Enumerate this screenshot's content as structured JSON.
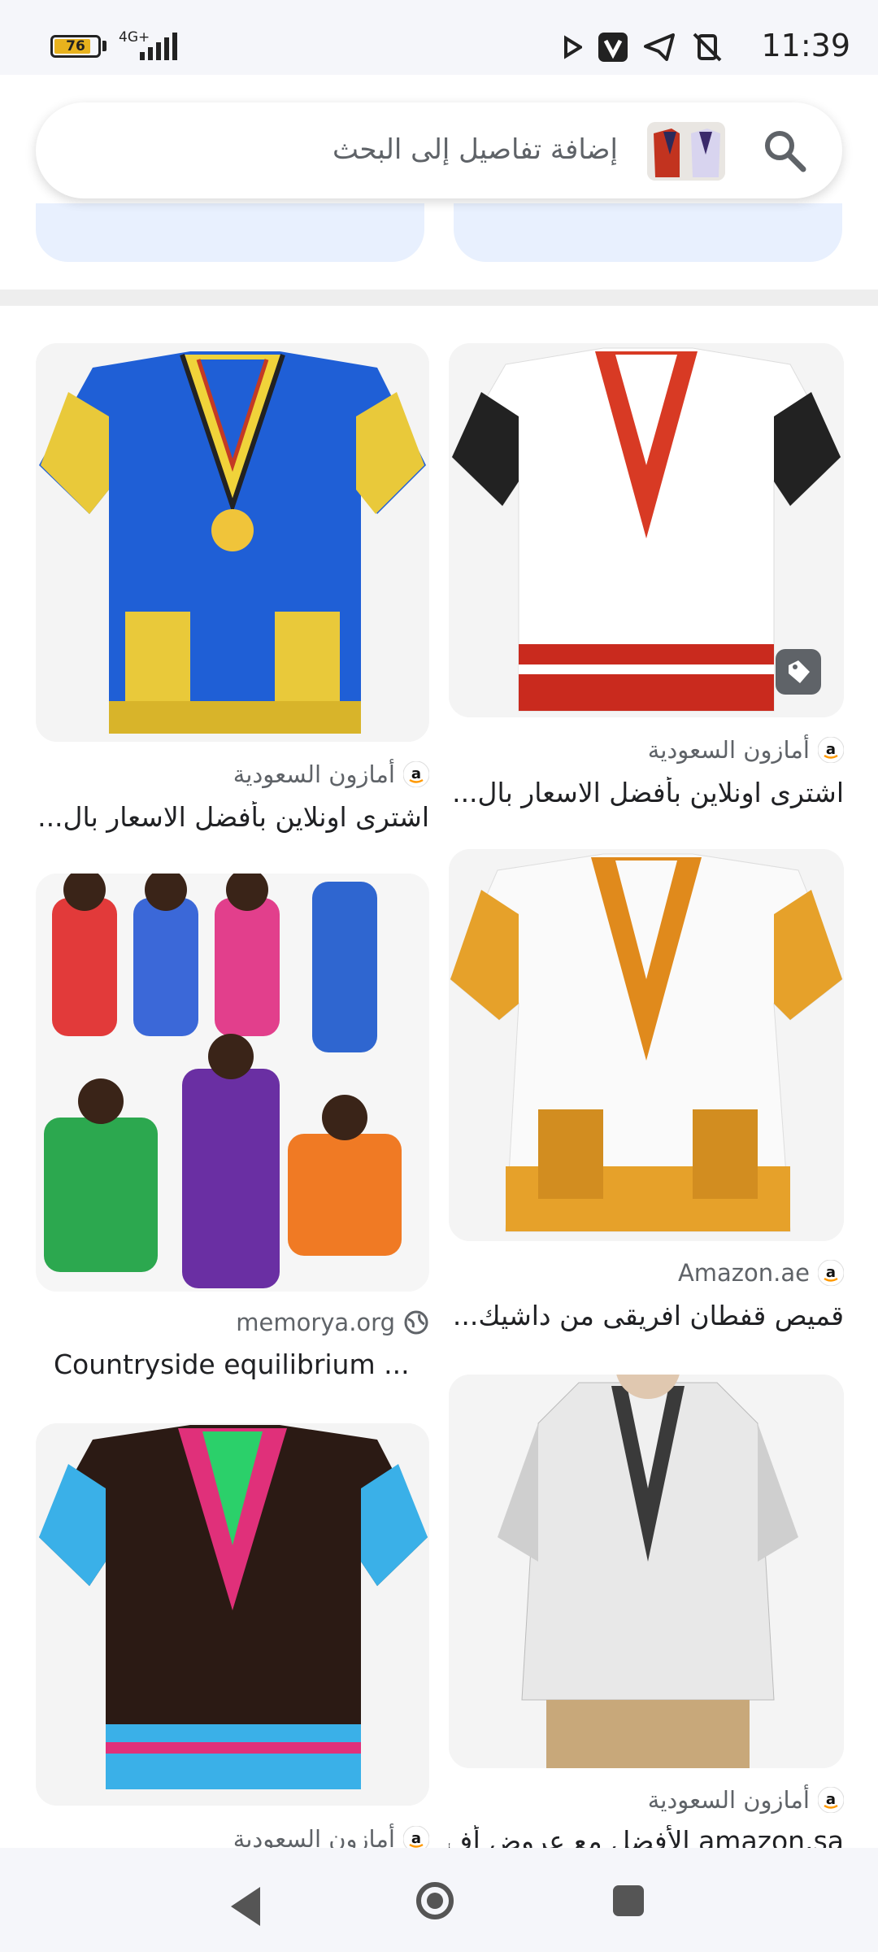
{
  "status_bar": {
    "battery_level": "76",
    "network": "4G+",
    "time": "11:39",
    "icons": [
      "play-icon",
      "vpn-v-icon",
      "telegram-icon",
      "vibrate-off-icon"
    ]
  },
  "search": {
    "placeholder": "إضافة تفاصيل إلى البحث",
    "thumbnail": "dashiki-shirts-thumbnail"
  },
  "results": [
    {
      "image": "blue-dashiki-shirt",
      "source": "أمازون السعودية",
      "source_icon": "amazon-icon",
      "title": "اشترى اونلاين بأفضل الاسعار بال..."
    },
    {
      "image": "white-red-dashiki-shirt",
      "source": "أمازون السعودية",
      "source_icon": "amazon-icon",
      "title": "اشترى اونلاين بأفضل الاسعار بال...",
      "badge": "tag-icon"
    },
    {
      "image": "dashiki-outfits-collage",
      "source": "memorya.org",
      "source_icon": "globe-icon",
      "title": "Countryside equilibrium ..."
    },
    {
      "image": "white-orange-dashiki-shirt",
      "source": "Amazon.ae",
      "source_icon": "amazon-icon",
      "title": "قميص قفطان افريقى من داشيك..."
    },
    {
      "image": "black-blue-dashiki-shirt",
      "source": "أمازون السعودية",
      "source_icon": "amazon-icon",
      "title": ""
    },
    {
      "image": "grey-white-dashiki-shirt",
      "source": "أمازون السعودية",
      "source_icon": "amazon-icon",
      "title": "amazon.sa الأفضل مع عروض أف"
    }
  ],
  "colors": {
    "accent": "#1a73e8",
    "chip_bg": "#e8f0fe",
    "amazon_orange": "#ff9900"
  }
}
